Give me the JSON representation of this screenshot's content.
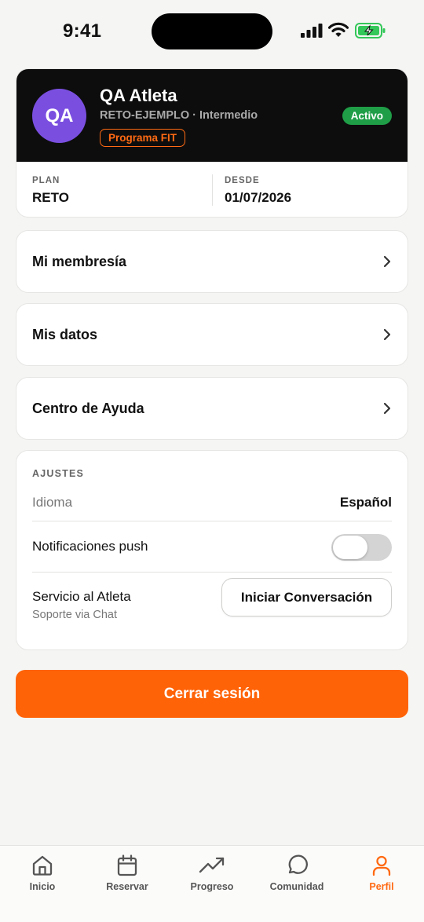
{
  "status_bar": {
    "time": "9:41"
  },
  "profile": {
    "initials": "QA",
    "name": "QA Atleta",
    "subtitle": "RETO-EJEMPLO · Intermedio",
    "program_badge": "Programa FIT",
    "status_badge": "Activo",
    "plan_label": "PLAN",
    "plan_value": "RETO",
    "since_label": "DESDE",
    "since_value": "01/07/2026"
  },
  "menu": [
    {
      "label": "Mi membresía",
      "icon": "chevron-right-icon"
    },
    {
      "label": "Mis datos",
      "icon": "chevron-right-icon"
    },
    {
      "label": "Centro de Ayuda",
      "icon": "chevron-right-icon"
    }
  ],
  "settings": {
    "title": "AJUSTES",
    "language_label": "Idioma",
    "language_value": "Español",
    "push_label": "Notificaciones push",
    "push_enabled": false,
    "service_title": "Servicio al Atleta",
    "service_subtitle": "Soporte via Chat",
    "chat_button": "Iniciar Conversación"
  },
  "logout_button": "Cerrar sesión",
  "tabbar": [
    {
      "label": "Inicio",
      "icon": "home-icon",
      "active": false
    },
    {
      "label": "Reservar",
      "icon": "calendar-icon",
      "active": false
    },
    {
      "label": "Progreso",
      "icon": "trending-up-icon",
      "active": false
    },
    {
      "label": "Comunidad",
      "icon": "chat-bubble-icon",
      "active": false
    },
    {
      "label": "Perfil",
      "icon": "user-icon",
      "active": true
    }
  ],
  "colors": {
    "accent": "#ff6308",
    "active_badge": "#1f9d47",
    "avatar": "#7a4fe0",
    "header_bg": "#0d0d0d"
  }
}
